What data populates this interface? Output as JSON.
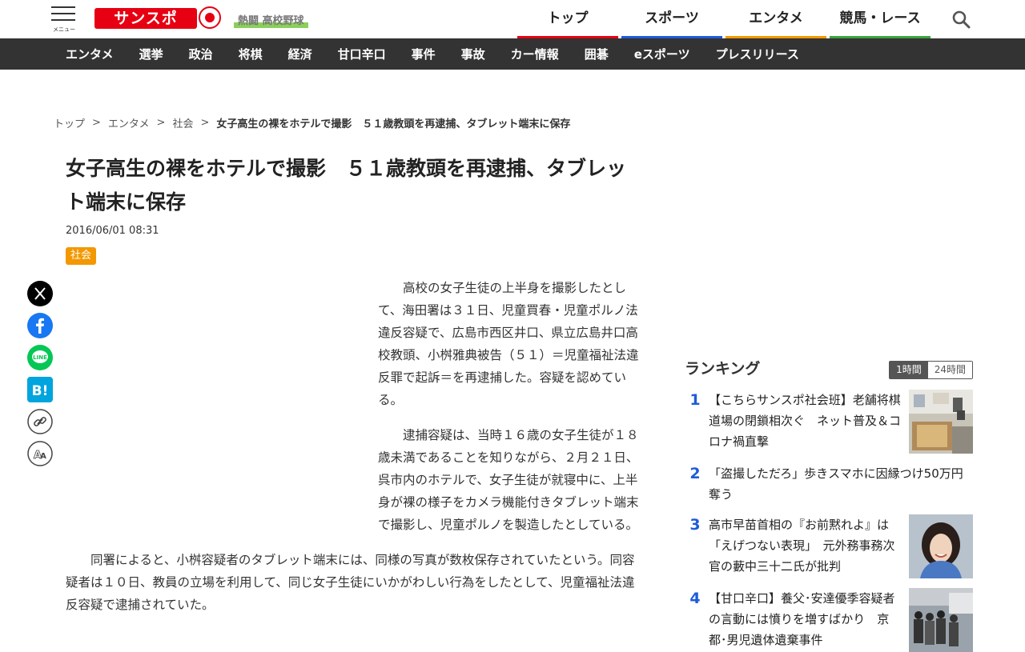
{
  "header": {
    "menu_label": "メニュー",
    "logo_text": "サンスポ",
    "hot_tag": "熱闘 高校野球",
    "nav": [
      {
        "label": "トップ",
        "color": "#e60012"
      },
      {
        "label": "スポーツ",
        "color": "#1e5bd9"
      },
      {
        "label": "エンタメ",
        "color": "#f39800"
      },
      {
        "label": "競馬・レース",
        "color": "#3aa53a"
      }
    ]
  },
  "subnav": [
    "エンタメ",
    "選挙",
    "政治",
    "将棋",
    "経済",
    "甘口辛口",
    "事件",
    "事故",
    "カー情報",
    "囲碁",
    "eスポーツ",
    "プレスリリース"
  ],
  "breadcrumb": {
    "items": [
      "トップ",
      "エンタメ",
      "社会"
    ],
    "separator": ">",
    "current": "女子高生の裸をホテルで撮影　５１歳教頭を再逮捕、タブレット端末に保存"
  },
  "article": {
    "title": "女子高生の裸をホテルで撮影　５１歳教頭を再逮捕、タブレット端末に保存",
    "date": "2016/06/01 08:31",
    "category": "社会",
    "paragraphs": [
      "高校の女子生徒の上半身を撮影したとして、海田署は３１日、児童買春・児童ポルノ法違反容疑で、広島市西区井口、県立広島井口高校教頭、小桝雅典被告（５１）＝児童福祉法違反罪で起訴＝を再逮捕した。容疑を認めている。",
      "逮捕容疑は、当時１６歳の女子生徒が１８歳未満であることを知りながら、２月２１日、呉市内のホテルで、女子生徒が就寝中に、上半身が裸の様子をカメラ機能付きタブレット端末で撮影し、児童ポルノを製造したとしている。",
      "同署によると、小桝容疑者のタブレット端末には、同様の写真が数枚保存されていたという。同容疑者は１０日、教員の立場を利用して、同じ女子生徒にいかがわしい行為をしたとして、児童福祉法違反容疑で逮捕されていた。"
    ]
  },
  "share": [
    "x-icon",
    "facebook-icon",
    "line-icon",
    "hatena-icon",
    "link-icon",
    "font-size-icon"
  ],
  "ranking": {
    "title": "ランキング",
    "tabs": [
      "1時間",
      "24時間"
    ],
    "items": [
      {
        "rank": "1",
        "text": "【こちらサンスポ社会班】老舗将棋道場の閉鎖相次ぐ　ネット普及＆コロナ禍直撃",
        "thumb": true
      },
      {
        "rank": "2",
        "text": "「盗撮しただろ」歩きスマホに因縁つけ50万円奪う",
        "thumb": false
      },
      {
        "rank": "3",
        "text": "高市早苗首相の『お前黙れよ』は「えげつない表現」　元外務事務次官の藪中三十二氏が批判",
        "thumb": true
      },
      {
        "rank": "4",
        "text": "【甘口辛口】養父･安達優季容疑者の言動には憤りを増すばかり　京都･男児遺体遺棄事件",
        "thumb": true
      }
    ]
  }
}
